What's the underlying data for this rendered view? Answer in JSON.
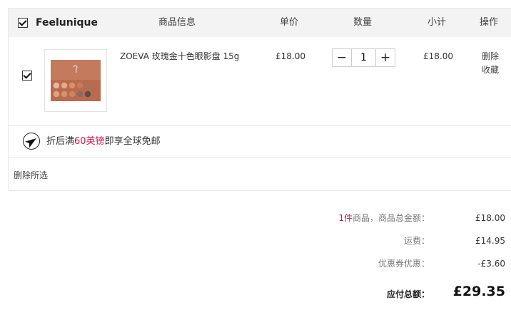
{
  "header": {
    "shop_name": "Feelunique",
    "col_info": "商品信息",
    "col_price": "单价",
    "col_qty": "数量",
    "col_subtotal": "小计",
    "col_actions": "操作"
  },
  "item": {
    "name": "ZOEVA 玫瑰金十色眼影盘 15g",
    "image_icon": "eyeshadow-palette-thumbnail",
    "price": "£18.00",
    "quantity": "1",
    "subtotal": "£18.00",
    "actions": {
      "delete": "删除",
      "favorite": "收藏"
    }
  },
  "shipping": {
    "icon": "plane-icon",
    "prefix": "折后满",
    "highlight": "60英镑",
    "suffix": "即享全球免邮"
  },
  "delete_selected": "删除所选",
  "summary": {
    "count": "1件",
    "items_label": "商品，商品总金额：",
    "items_total": "£18.00",
    "shipping_label": "运费：",
    "shipping_fee": "£14.95",
    "coupon_label": "优惠券优惠：",
    "coupon_value": "-£3.60",
    "total_label": "应付总额：",
    "total_value": "£29.35"
  },
  "colors": {
    "accent_red": "#c8194b",
    "header_bg": "#f3f3f3",
    "border": "#e8e8e8"
  }
}
